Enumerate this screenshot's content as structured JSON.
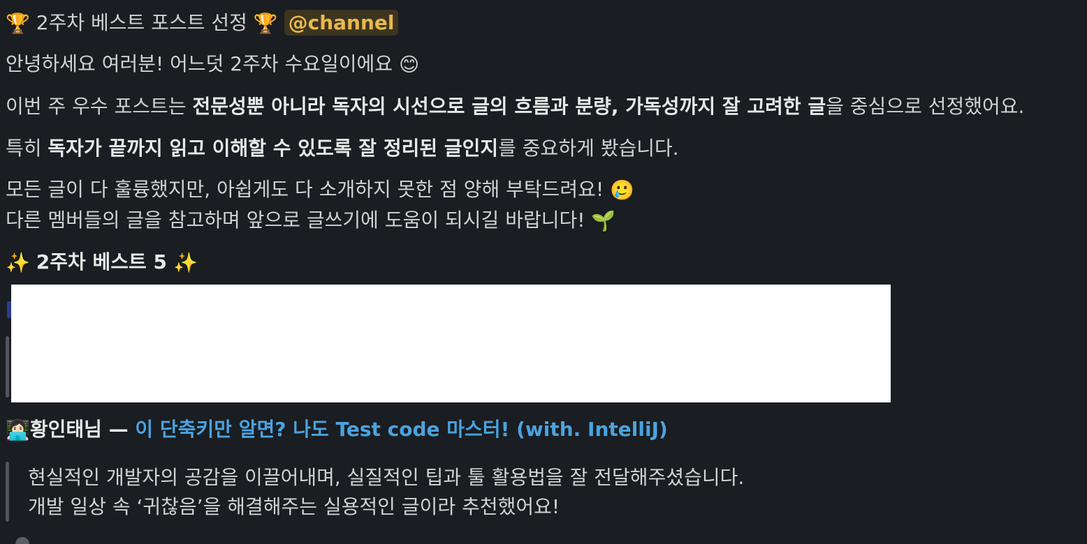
{
  "announcement": {
    "title_line": {
      "title": "2주차 베스트 포스트 선정",
      "mention": "@channel"
    },
    "greeting": "안녕하세요 여러분! 어느덧 2주차 수요일이에요",
    "criteria": {
      "prefix": "이번 주 우수 포스트는 ",
      "bold": "전문성뿐 아니라 독자의 시선으로 글의 흐름과 분량, 가독성까지 잘 고려한 글",
      "suffix": "을 중심으로 선정했어요."
    },
    "emphasis": {
      "prefix": "특히 ",
      "bold": "독자가 끝까지 읽고 이해할 수 있도록 잘 정리된 글인지",
      "suffix": "를 중요하게 봤습니다."
    },
    "apology": "모든 글이 다 훌륭했지만, 아쉽게도 다 소개하지 못한 점 양해 부탁드려요!",
    "encouragement": "다른 멤버들의 글을 참고하며 앞으로 글쓰기에 도움이 되시길 바랍니다!",
    "best_heading": "2주차 베스트  5"
  },
  "featured_post": {
    "author": "황인태님",
    "separator": " — ",
    "post_title": "이 단축키만 알면? 나도 Test code 마스터! (with. IntelliJ)",
    "comment_line1": "현실적인 개발자의 공감을 이끌어내며, 실질적인 팁과 툴 활용법을 잘 전달해주셨습니다.",
    "comment_line2": "개발 일상 속 ‘귀찮음’을 해결해주는 실용적인 글이라 추천했어요!"
  },
  "emojis": {
    "trophy": "🏆",
    "smile": "😊",
    "holding_back_tears": "🥲",
    "seedling": "🌱",
    "sparkles": "✨",
    "technologist": "👩🏻‍💻"
  },
  "colors": {
    "background": "#1a1d21",
    "text": "#d1d2d3",
    "mention_bg": "#3c3520",
    "mention_fg": "#e8b84e",
    "link": "#4aa3df",
    "quote_bar": "#52565c"
  }
}
